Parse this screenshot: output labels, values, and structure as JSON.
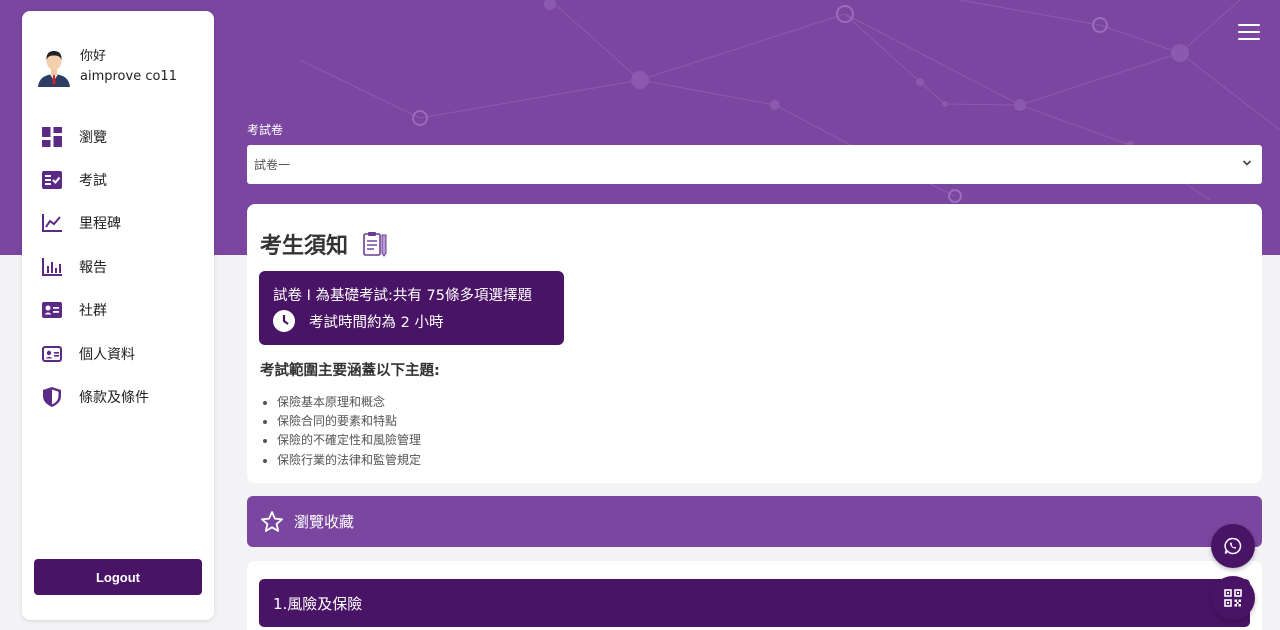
{
  "colors": {
    "brand": "#7a46a0",
    "brand_dark": "#4a1466",
    "background": "#f3f3f5"
  },
  "user": {
    "greeting": "你好",
    "name": "aimprove co11"
  },
  "sidebar": {
    "items": [
      {
        "label": "瀏覽",
        "icon": "dashboard-icon"
      },
      {
        "label": "考試",
        "icon": "exam-checklist-icon"
      },
      {
        "label": "里程碑",
        "icon": "line-chart-icon"
      },
      {
        "label": "報告",
        "icon": "bar-chart-icon"
      },
      {
        "label": "社群",
        "icon": "community-card-icon"
      },
      {
        "label": "個人資料",
        "icon": "id-card-icon"
      },
      {
        "label": "條款及條件",
        "icon": "shield-icon"
      }
    ],
    "logout_label": "Logout"
  },
  "exam_select": {
    "label": "考試卷",
    "value": "試卷一"
  },
  "notice": {
    "title": "考生須知",
    "line1": "試卷 I 為基礎考試:共有 75條多項選擇題",
    "line2": "考試時間約為 2 小時",
    "topics_heading": "考試範圍主要涵蓋以下主題:",
    "topics": [
      "保險基本原理和概念",
      "保險合同的要素和特點",
      "保險的不確定性和風險管理",
      "保險行業的法律和監管規定"
    ]
  },
  "favorites": {
    "label": "瀏覽收藏"
  },
  "chapter": {
    "label": "1.風險及保險"
  }
}
